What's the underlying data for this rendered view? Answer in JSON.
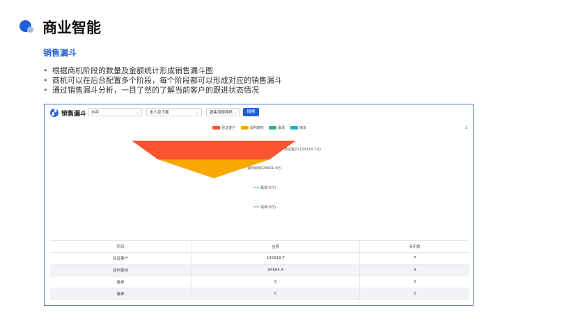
{
  "slide": {
    "title": "商业智能",
    "section": "销售漏斗",
    "bullets": [
      "根据商机阶段的数量及金额统计形成销售漏斗图",
      "商机可以在后台配置多个阶段，每个阶段都可以形成对应的销售漏斗",
      "通过销售漏斗分析，一目了然的了解当前客户的跟进状态情况"
    ]
  },
  "report": {
    "title": "销售漏斗",
    "period_select": "本年",
    "scope_select": "本人及下属",
    "type_select": "销售流程商机",
    "search_label": "搜索"
  },
  "chart_data": {
    "type": "funnel",
    "stages": [
      {
        "name": "验证客户",
        "amount": 139318.7,
        "count": 7,
        "label": "验证客户(139318.7元)",
        "color": "#fb5430"
      },
      {
        "name": "谈判审核",
        "amount": 94604.4,
        "count": 3,
        "label": "谈判审核(94604.4元)",
        "color": "#f8a800"
      },
      {
        "name": "赢单",
        "amount": 0,
        "count": 0,
        "label": "赢单(0元)",
        "color": "#2bb673"
      },
      {
        "name": "输单",
        "amount": 0,
        "count": 0,
        "label": "输单(0元)",
        "color": "#15b4c5"
      }
    ]
  },
  "table": {
    "headers": [
      "阶段",
      "金额",
      "商机数"
    ],
    "rows": [
      [
        "验证客户",
        "139318.7",
        "7"
      ],
      [
        "谈判审核",
        "94604.4",
        "3"
      ],
      [
        "赢单",
        "0",
        "0"
      ],
      [
        "输单",
        "0",
        "0"
      ]
    ]
  }
}
